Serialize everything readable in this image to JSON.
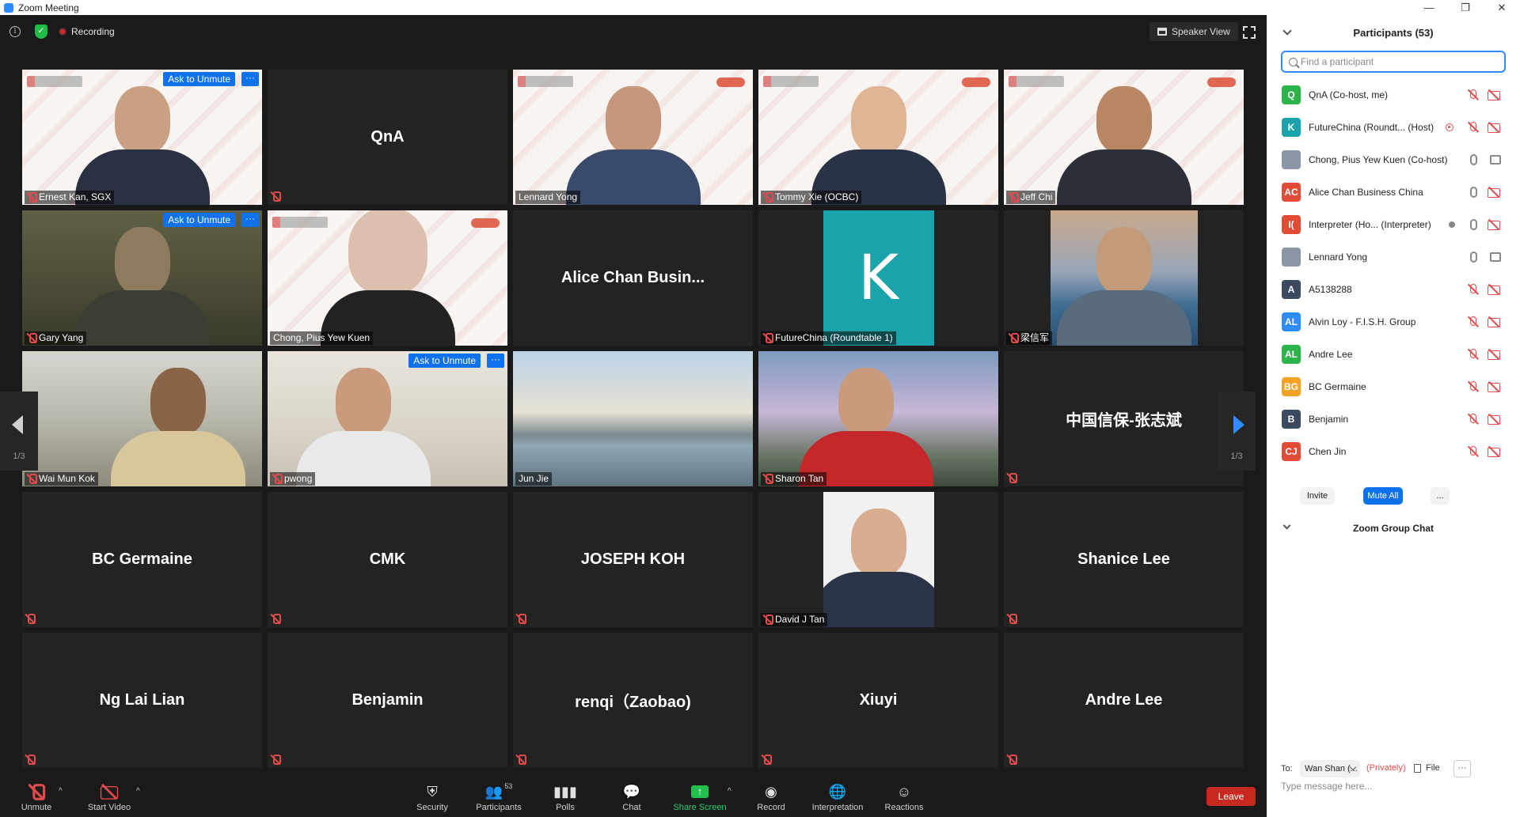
{
  "window": {
    "title": "Zoom Meeting"
  },
  "topbar": {
    "recording_label": "Recording",
    "view_label": "Speaker View"
  },
  "tiles": [
    {
      "name": "Ernest Kan, SGX",
      "ask": "Ask to Unmute"
    },
    {
      "name": "QnA"
    },
    {
      "name": "Lennard Yong"
    },
    {
      "name": "Tommy Xie (OCBC)"
    },
    {
      "name": "Jeff Chi"
    },
    {
      "name": "Gary Yang",
      "ask": "Ask to Unmute"
    },
    {
      "name": "Chong, Pius Yew Kuen"
    },
    {
      "name": "Alice  Chan  Busin..."
    },
    {
      "name": "FutureChina (Roundtable 1)",
      "initial": "K"
    },
    {
      "name": "梁信军"
    },
    {
      "name": "Wai Mun Kok"
    },
    {
      "name": "pwong",
      "ask": "Ask to Unmute"
    },
    {
      "name": "Jun Jie"
    },
    {
      "name": "Sharon Tan"
    },
    {
      "name": "中国信保-张志斌"
    },
    {
      "name": "BC Germaine"
    },
    {
      "name": "CMK"
    },
    {
      "name": "JOSEPH KOH"
    },
    {
      "name": "David J Tan"
    },
    {
      "name": "Shanice Lee"
    },
    {
      "name": "Ng Lai Lian"
    },
    {
      "name": "Benjamin"
    },
    {
      "name": "renqi（Zaobao)"
    },
    {
      "name": "Xiuyi"
    },
    {
      "name": "Andre Lee"
    }
  ],
  "pager": {
    "left": "1/3",
    "right": "1/3"
  },
  "more_label": "···",
  "toolbar": {
    "unmute": "Unmute",
    "start_video": "Start Video",
    "security": "Security",
    "participants": "Participants",
    "participants_count": "53",
    "polls": "Polls",
    "chat": "Chat",
    "share_screen": "Share Screen",
    "record": "Record",
    "interpretation": "Interpretation",
    "reactions": "Reactions",
    "leave": "Leave"
  },
  "panel": {
    "title": "Participants (53)",
    "search_placeholder": "Find a participant",
    "participants": [
      {
        "initials": "Q",
        "color": "#2bb44a",
        "name": "QnA (Co-host, me)"
      },
      {
        "initials": "K",
        "color": "#1aa3ab",
        "name": "FutureChina (Roundt...  (Host)"
      },
      {
        "initials": "",
        "color": "#8a96a6",
        "name": "Chong, Pius Yew Kuen (Co-host)"
      },
      {
        "initials": "AC",
        "color": "#e24b35",
        "name": "Alice Chan Business China"
      },
      {
        "initials": "I(",
        "color": "#e24b35",
        "name": "Interpreter (Ho... (Interpreter)"
      },
      {
        "initials": "",
        "color": "#8a96a6",
        "name": "Lennard Yong"
      },
      {
        "initials": "A",
        "color": "#3b4a5e",
        "name": "A5138288"
      },
      {
        "initials": "AL",
        "color": "#2d8cff",
        "name": "Alvin Loy - F.I.S.H. Group"
      },
      {
        "initials": "AL",
        "color": "#2bb44a",
        "name": "Andre Lee"
      },
      {
        "initials": "BG",
        "color": "#f2a227",
        "name": "BC Germaine"
      },
      {
        "initials": "B",
        "color": "#3b4a5e",
        "name": "Benjamin"
      },
      {
        "initials": "CJ",
        "color": "#e24b35",
        "name": "Chen Jin"
      }
    ],
    "invite": "Invite",
    "mute_all": "Mute All",
    "more": "...",
    "chat_title": "Zoom Group Chat",
    "chat_to": "To:",
    "chat_recipient": "Wan Shan (...",
    "chat_privately": "(Privately)",
    "chat_file": "File",
    "chat_more": "···",
    "chat_placeholder": "Type message here..."
  }
}
